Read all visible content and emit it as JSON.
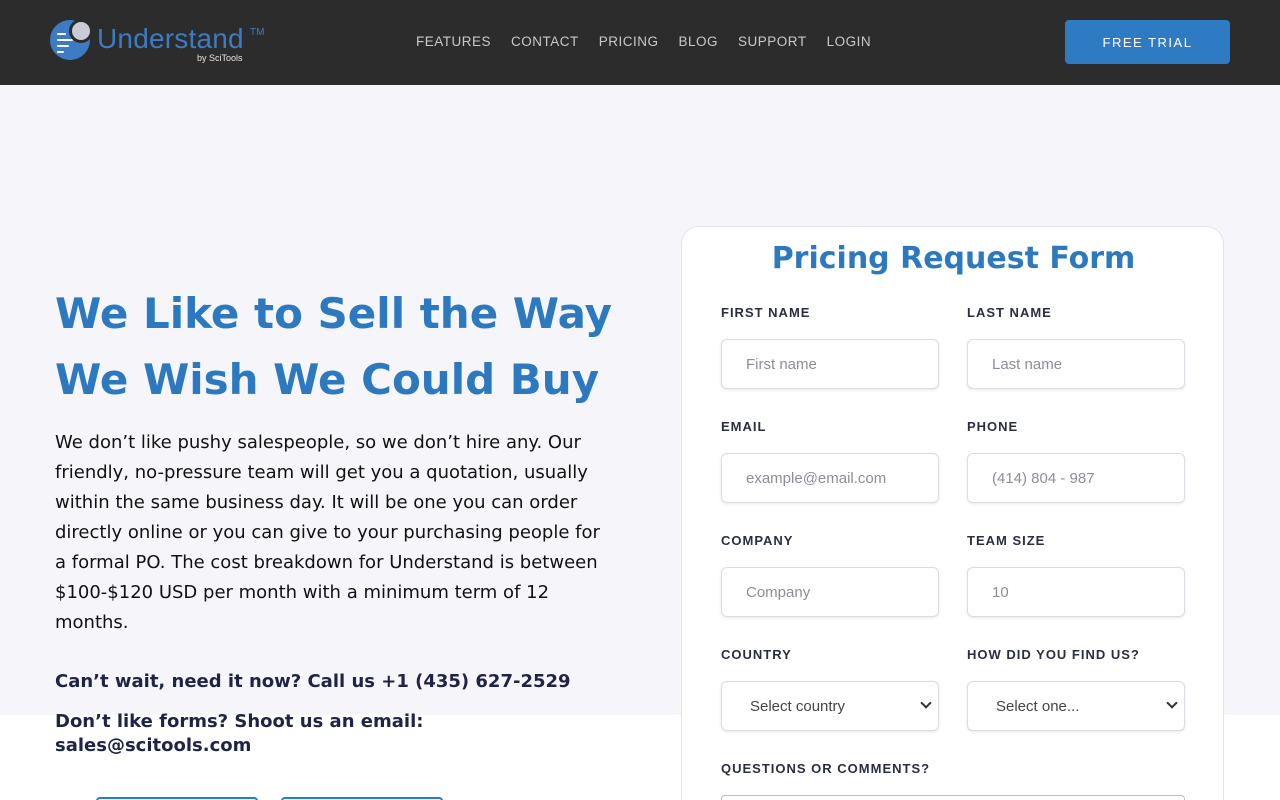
{
  "header": {
    "logo_text": "Understand",
    "logo_tm": "TM",
    "logo_sub": "by SciTools",
    "nav": [
      "FEATURES",
      "CONTACT",
      "PRICING",
      "BLOG",
      "SUPPORT",
      "LOGIN"
    ],
    "cta_label": "FREE TRIAL"
  },
  "hero": {
    "title": "We Like to Sell the Way We Wish We Could Buy",
    "body": "We don’t like pushy salespeople, so we don’t hire any. Our friendly, no-pressure team will get you a quotation, usually within the same business day. It will be one you can order directly online or you can give to your purchasing people for a formal PO. The cost breakdown for Understand is between $100-$120 USD per month with a minimum term of 12 months.",
    "call_text": "Can’t wait, need it now? Call us +1 (435) 627-2529",
    "email_text": "Don’t like forms? Shoot us an email: sales@scitools.com"
  },
  "form": {
    "title": "Pricing Request Form",
    "first_name": {
      "label": "FIRST NAME",
      "placeholder": "First name"
    },
    "last_name": {
      "label": "LAST NAME",
      "placeholder": "Last name"
    },
    "email": {
      "label": "EMAIL",
      "placeholder": "example@email.com"
    },
    "phone": {
      "label": "PHONE",
      "placeholder": "(414) 804 - 987"
    },
    "company": {
      "label": "COMPANY",
      "placeholder": "Company"
    },
    "team_size": {
      "label": "TEAM SIZE",
      "placeholder": "10"
    },
    "country": {
      "label": "COUNTRY",
      "selected": "Select country"
    },
    "found_us": {
      "label": "HOW DID YOU FIND US?",
      "selected": "Select one..."
    },
    "comments": {
      "label": "QUESTIONS OR COMMENTS?"
    }
  },
  "colors": {
    "brand_blue": "#2d79bf",
    "header_bg": "#2c2c2c",
    "cta_bg": "#2f7bc3",
    "dark_navy": "#1f2447"
  }
}
